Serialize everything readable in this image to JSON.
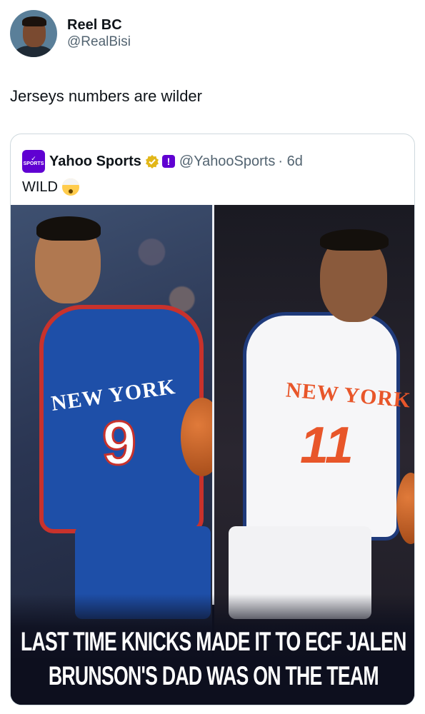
{
  "tweet": {
    "author_name": "Reel BC",
    "author_handle": "@RealBisi",
    "text": "Jerseys numbers are wilder"
  },
  "quoted_tweet": {
    "logo_text": "SPORTS",
    "author_name": "Yahoo Sports",
    "author_handle": "@YahooSports",
    "age": "· 6d",
    "text": "WILD",
    "emoji": "exploding-head-emoji",
    "media": {
      "left_jersey": {
        "team": "NEW YORK",
        "number": "9",
        "colors": {
          "body": "#1e4fa8",
          "trim": "#c8322c",
          "number": "#ffffff"
        }
      },
      "right_jersey": {
        "team": "NEW YORK",
        "number": "11",
        "colors": {
          "body": "#f6f6f8",
          "trim": "#1f3a7a",
          "number": "#e8562a"
        }
      },
      "headline_lines": [
        "LAST TIME KNICKS MADE IT TO ECF JALEN",
        "BRUNSON'S DAD WAS ON THE TEAM"
      ]
    }
  },
  "colors": {
    "brand": "#6001d2",
    "verified": "#e2b719",
    "muted": "#536471"
  }
}
